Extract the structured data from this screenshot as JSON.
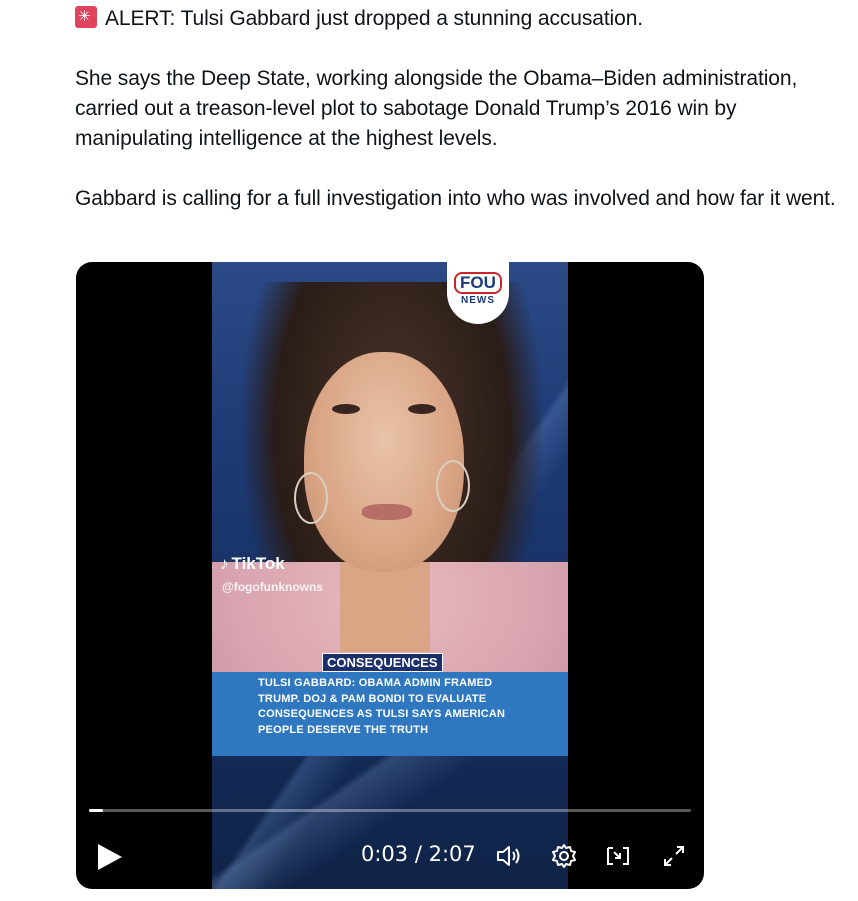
{
  "post": {
    "alert_line": "ALERT: Tulsi Gabbard just dropped a stunning accusation.",
    "paragraph_2": "She says the Deep State, working alongside the Obama–Biden administration, carried out a treason-level plot to sabotage Donald Trump’s 2016 win by manipulating intelligence at the highest levels.",
    "paragraph_3": "Gabbard is calling for a full investigation into who was involved and how far it went.",
    "alert_icon": "rotating-light-icon"
  },
  "video": {
    "logo_top": "FOU",
    "logo_bottom": "NEWS",
    "tiktok_label": "TikTok",
    "tiktok_handle": "@fogofunknowns",
    "tag": "CONSEQUENCES",
    "caption": "TULSI GABBARD: OBAMA ADMIN FRAMED TRUMP. DOJ & PAM BONDI TO EVALUATE CONSEQUENCES AS TULSI SAYS AMERICAN PEOPLE DESERVE THE TRUTH",
    "time_display": "0:03 / 2:07",
    "progress_fraction": 0.024,
    "icons": [
      "play-icon",
      "volume-icon",
      "settings-gear-icon",
      "picture-in-picture-icon",
      "fullscreen-icon"
    ]
  }
}
